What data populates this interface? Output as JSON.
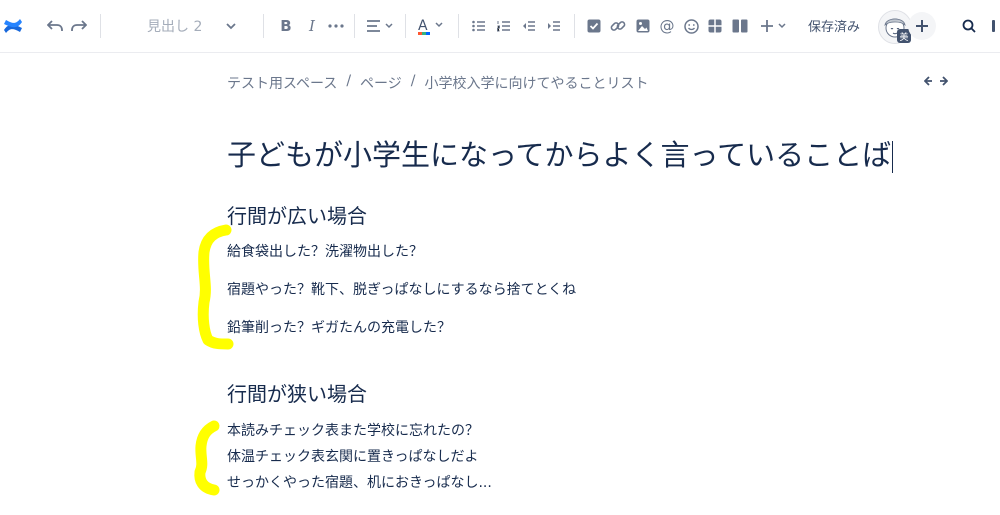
{
  "toolbar": {
    "text_style": "見出し 2",
    "save_status": "保存済み",
    "avatar_badge": "美"
  },
  "breadcrumb": {
    "items": [
      "テスト用スペース",
      "ページ",
      "小学校入学に向けてやることリスト"
    ],
    "separator": "/"
  },
  "page": {
    "title": "子どもが小学生になってからよく言っていることば",
    "sections": [
      {
        "heading": "行間が広い場合",
        "lines": [
          "給食袋出した？洗濯物出した？",
          "宿題やった？靴下、脱ぎっぱなしにするなら捨てとくね",
          "鉛筆削った？ギガたんの充電した？"
        ]
      },
      {
        "heading": "行間が狭い場合",
        "lines": [
          "本読みチェック表また学校に忘れたの？",
          "体温チェック表玄関に置きっぱなしだよ",
          "せっかくやった宿題、机におきっぱなし..."
        ]
      }
    ]
  },
  "colors": {
    "brand": "#1868db",
    "highlight": "#ffff00",
    "text": "#172b4d",
    "muted": "#6b778c"
  },
  "icons": [
    "confluence-logo-icon",
    "undo-icon",
    "redo-icon",
    "chevron-down-icon",
    "bold-icon",
    "italic-icon",
    "more-icon",
    "align-icon",
    "text-color-icon",
    "bullet-list-icon",
    "numbered-list-icon",
    "outdent-icon",
    "indent-icon",
    "task-icon",
    "link-icon",
    "image-icon",
    "mention-icon",
    "emoji-icon",
    "table-icon",
    "layout-icon",
    "insert-plus-icon",
    "search-icon",
    "expand-width-icon"
  ]
}
